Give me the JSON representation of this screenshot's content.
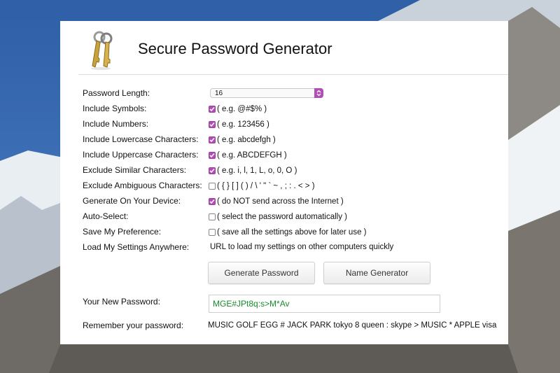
{
  "page": {
    "title": "Secure Password Generator"
  },
  "form": {
    "length": {
      "label": "Password Length:",
      "value": "16"
    },
    "symbols": {
      "label": "Include Symbols:",
      "checked": true,
      "hint": "( e.g. @#$% )"
    },
    "numbers": {
      "label": "Include Numbers:",
      "checked": true,
      "hint": "( e.g. 123456 )"
    },
    "lowercase": {
      "label": "Include Lowercase Characters:",
      "checked": true,
      "hint": "( e.g. abcdefgh )"
    },
    "uppercase": {
      "label": "Include Uppercase Characters:",
      "checked": true,
      "hint": "( e.g. ABCDEFGH )"
    },
    "similar": {
      "label": "Exclude Similar Characters:",
      "checked": true,
      "hint": "( e.g. i, l, 1, L, o, 0, O )"
    },
    "ambiguous": {
      "label": "Exclude Ambiguous Characters:",
      "checked": false,
      "hint": "( { } [ ] ( ) / \\ ' \" ` ~ , ; : . < > )"
    },
    "device": {
      "label": "Generate On Your Device:",
      "checked": true,
      "hint": "( do NOT send across the Internet )"
    },
    "autoselect": {
      "label": "Auto-Select:",
      "checked": false,
      "hint": "( select the password automatically )"
    },
    "preference": {
      "label": "Save My Preference:",
      "checked": false,
      "hint": "( save all the settings above for later use )"
    },
    "load": {
      "label": "Load My Settings Anywhere:",
      "link": "URL to load my settings on other computers quickly"
    }
  },
  "buttons": {
    "generate": "Generate Password",
    "name_generator": "Name Generator"
  },
  "result": {
    "label": "Your New Password:",
    "password": "MGE#JPt8q:s>M*Av",
    "remember_label": "Remember your password:",
    "mnemonic": "MUSIC GOLF EGG # JACK PARK tokyo 8 queen : skype > MUSIC * APPLE visa"
  },
  "colors": {
    "accent": "#b14fb5",
    "password_text": "#1a8a2e"
  }
}
